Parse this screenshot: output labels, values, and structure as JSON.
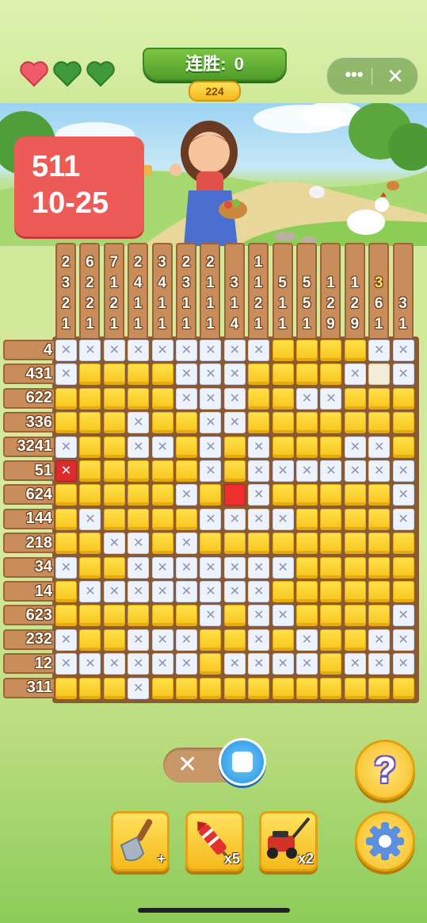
{
  "header": {
    "lives": {
      "total": 3,
      "remaining": 1
    },
    "streak_label": "连胜:",
    "streak_value": "0",
    "coins": "224",
    "menu_icon": "more-dots-icon",
    "close_icon": "close-icon"
  },
  "level": {
    "line1": "511",
    "line2": "10-25"
  },
  "colors": {
    "filled": "#f7c51c",
    "crossed": "#eef2fb",
    "error": "#dd2b2b",
    "clue_bg": "#c98d5c"
  },
  "puzzle": {
    "col_clues": [
      [
        "2",
        "3",
        "2",
        "1"
      ],
      [
        "6",
        "2",
        "2",
        "1"
      ],
      [
        "7",
        "1",
        "2",
        "1"
      ],
      [
        "2",
        "4",
        "1",
        "1"
      ],
      [
        "3",
        "4",
        "1",
        "1"
      ],
      [
        "2",
        "3",
        "1",
        "1"
      ],
      [
        "2",
        "1",
        "1",
        "1"
      ],
      [
        "3",
        "1",
        "4"
      ],
      [
        "1",
        "1",
        "2",
        "1"
      ],
      [
        "5",
        "1",
        "1"
      ],
      [
        "5",
        "5",
        "1"
      ],
      [
        "1",
        "2",
        "9"
      ],
      [
        "1",
        "2",
        "9"
      ],
      [
        "3",
        "6",
        "1"
      ],
      [
        "3",
        "1"
      ]
    ],
    "row_clues": [
      "4",
      "431",
      "622",
      "336",
      "3241",
      "51",
      "624",
      "144",
      "218",
      "34",
      "14",
      "623",
      "232",
      "12",
      "311"
    ],
    "grid": [
      "xxxxxxxxxffffxx",
      "xffffxxxffffxex",
      "fffffxxxffxxfff",
      "fffxffxxfffffff",
      "xffxxfxfxfffxxf",
      "Efffffxfxxxxxxx",
      "fffffxfRxfffffx",
      "fxffffxxxxffffx",
      "ffxxfxfffffffff",
      "xffxxxxxxxfffff",
      "fxxxxxxxxffffff",
      "ffffffxfxxffffx",
      "xffxxxffxfxffxx",
      "xxxxxxfxxxxfxxx",
      "fffxfffffffffff"
    ]
  },
  "controls": {
    "mode_toggle": {
      "off_icon": "cross-icon",
      "on_icon": "square-icon",
      "state": "fill"
    },
    "help_label": "?",
    "tools": [
      {
        "name": "shovel",
        "icon": "shovel-icon",
        "count": "+"
      },
      {
        "name": "firework",
        "icon": "firework-icon",
        "count": "x5"
      },
      {
        "name": "lawnmower",
        "icon": "lawnmower-icon",
        "count": "x2"
      }
    ],
    "settings_icon": "gear-icon"
  }
}
